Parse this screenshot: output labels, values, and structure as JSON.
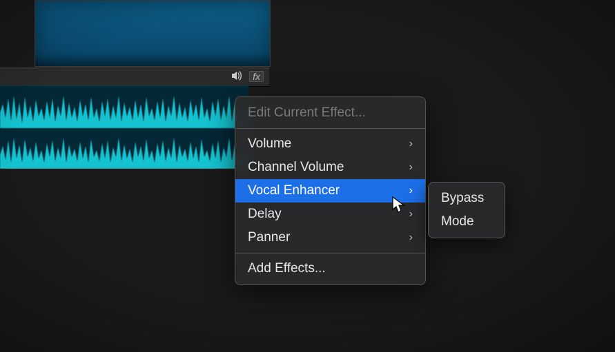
{
  "menu": {
    "header": "Edit Current Effect...",
    "items": [
      {
        "label": "Volume",
        "has_sub": true,
        "highlight": false
      },
      {
        "label": "Channel Volume",
        "has_sub": true,
        "highlight": false
      },
      {
        "label": "Vocal Enhancer",
        "has_sub": true,
        "highlight": true
      },
      {
        "label": "Delay",
        "has_sub": true,
        "highlight": false
      },
      {
        "label": "Panner",
        "has_sub": true,
        "highlight": false
      }
    ],
    "footer": "Add Effects..."
  },
  "submenu": {
    "items": [
      {
        "label": "Bypass"
      },
      {
        "label": "Mode"
      }
    ]
  },
  "track_header": {
    "speaker_icon": "speaker-icon",
    "fx_label": "fx"
  }
}
